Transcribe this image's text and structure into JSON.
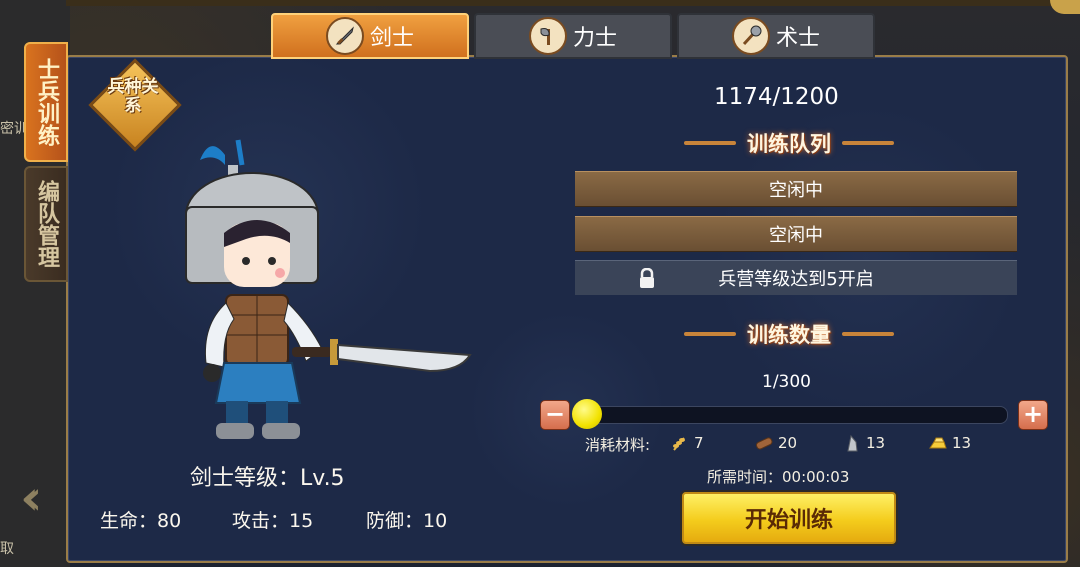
{
  "tabs": [
    {
      "label": "剑士",
      "icon": "sword-icon"
    },
    {
      "label": "力士",
      "icon": "axe-icon"
    },
    {
      "label": "术士",
      "icon": "staff-icon"
    }
  ],
  "side_tabs": [
    {
      "label": "士兵训练"
    },
    {
      "label": "编队管理"
    }
  ],
  "badge": {
    "text": "兵种关系"
  },
  "unit": {
    "level_text": "剑士等级：Lv.5",
    "hp": "生命：80",
    "attack": "攻击：15",
    "defense": "防御：10"
  },
  "capacity": "1174/1200",
  "queue": {
    "title": "训练队列",
    "slots": [
      {
        "text": "空闲中"
      },
      {
        "text": "空闲中"
      },
      {
        "text": "兵营等级达到5开启"
      }
    ]
  },
  "quantity": {
    "title": "训练数量",
    "count": "1/300",
    "slider_fraction": 0.0033,
    "minus": "−",
    "plus": "+"
  },
  "cost": {
    "label": "消耗材料:",
    "wheat": "7",
    "wood": "20",
    "stone": "13",
    "gold": "13"
  },
  "time": "所需时间：00:00:03",
  "start_button": "开始训练",
  "background": {
    "left_text_1": "密训",
    "left_text_2": "取"
  },
  "colors": {
    "accent": "#d9731f",
    "panel": "#1d2947",
    "button": "#f4cc1c"
  }
}
